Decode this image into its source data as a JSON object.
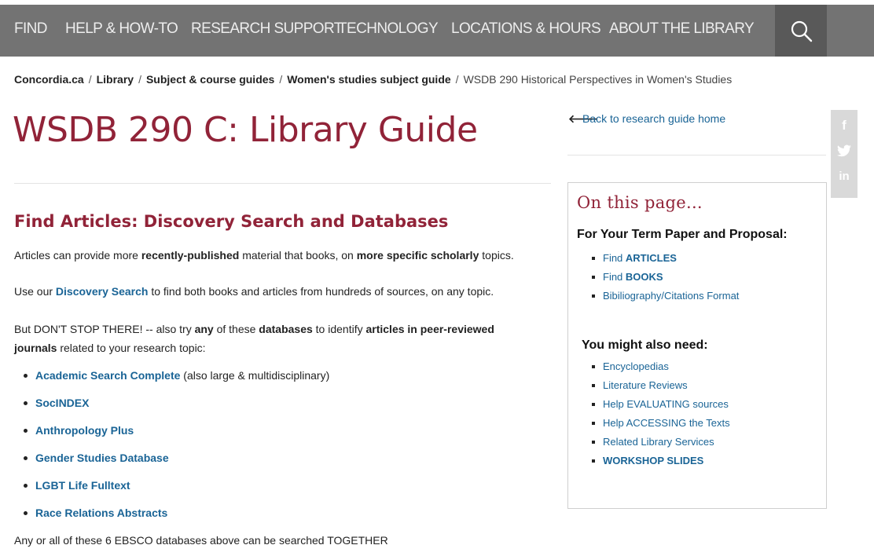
{
  "nav": {
    "items": [
      "FIND",
      "HELP & HOW-TO",
      "RESEARCH SUPPORT",
      "TECHNOLOGY",
      "LOCATIONS & HOURS",
      "ABOUT THE LIBRARY"
    ]
  },
  "breadcrumb": {
    "items": [
      "Concordia.ca",
      "Library",
      "Subject & course guides",
      "Women's studies subject guide"
    ],
    "current": "WSDB 290 Historical Perspectives in Women's Studies",
    "separator": "/"
  },
  "page": {
    "title": "WSDB 290 C: Library Guide"
  },
  "section": {
    "heading_prefix": "Find Articles: ",
    "heading_bold1": "Discovery Search",
    "heading_mid": " and ",
    "heading_bold2": "Databases"
  },
  "intro": {
    "p1_a": "Articles can provide more ",
    "p1_b": "recently-published",
    "p1_c": " material that books, on ",
    "p1_d": "more specific scholarly",
    "p1_e": " topics.",
    "p2_a": "Use our ",
    "p2_link": "Discovery Search",
    "p2_b": " to find both books and articles from hundreds of sources, on any topic.",
    "p3_a": "But DON'T STOP THERE! -- also try ",
    "p3_b": "any",
    "p3_c": " of these ",
    "p3_d": "databases",
    "p3_e": " to identify ",
    "p3_f": "articles in peer-reviewed",
    "p3_g": "journals",
    "p3_h": "  related to your research topic:"
  },
  "databases": [
    {
      "name": "Academic Search Complete",
      "note": " (also large & multidisciplinary)"
    },
    {
      "name": "SocINDEX",
      "note": ""
    },
    {
      "name": "Anthropology Plus",
      "note": ""
    },
    {
      "name": "Gender Studies Database",
      "note": ""
    },
    {
      "name": "LGBT Life Fulltext",
      "note": ""
    },
    {
      "name": "Race Relations Abstracts",
      "note": ""
    }
  ],
  "footer_note": "Any or all of these 6 EBSCO  databases above can be searched TOGETHER",
  "sidebar": {
    "back_label": "Back to research guide home",
    "panel_title": "On this page...",
    "group1_heading": "For Your Term Paper and Proposal:",
    "group1_items": [
      {
        "pre": "Find ",
        "bold": "ARTICLES"
      },
      {
        "pre": "Find ",
        "bold": "BOOKS"
      },
      {
        "pre": "Bibiliography/Citations Format",
        "bold": ""
      }
    ],
    "group2_heading": "You might also need:",
    "group2_items": [
      {
        "pre": "Encyclopedias",
        "bold": ""
      },
      {
        "pre": "Literature Reviews",
        "bold": ""
      },
      {
        "pre": "Help EVALUATING sources",
        "bold": ""
      },
      {
        "pre": "Help ACCESSING the Texts",
        "bold": ""
      },
      {
        "pre": "Related Library Services",
        "bold": ""
      },
      {
        "pre": "",
        "bold": "WORKSHOP SLIDES"
      }
    ]
  },
  "social": [
    "facebook-icon",
    "twitter-icon",
    "linkedin-icon"
  ],
  "colors": {
    "nav_bg": "#737373",
    "search_bg": "#595959",
    "brand_burgundy": "#912338",
    "link_blue": "#1a6496"
  }
}
